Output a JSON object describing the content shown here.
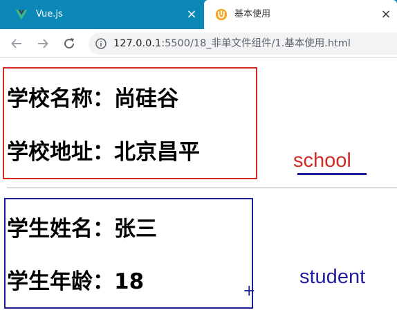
{
  "tabs": [
    {
      "title": "Vue.js",
      "active": false,
      "icon": "vue-logo-icon"
    },
    {
      "title": "基本使用",
      "active": true,
      "icon": "live-server-icon"
    }
  ],
  "toolbar": {
    "url_host": "127.0.0.1",
    "url_rest": ":5500/18_非单文件组件/1.基本使用.html"
  },
  "school": {
    "name_line": "学校名称：尚硅谷",
    "address_line": "学校地址：北京昌平",
    "annotation": "school"
  },
  "student": {
    "name_line": "学生姓名：张三",
    "age_line": "学生年龄：18",
    "annotation": "student"
  },
  "colors": {
    "tabstrip": "#0b87b8",
    "school_accent": "#d32b23",
    "student_accent": "#1f1f9b"
  }
}
